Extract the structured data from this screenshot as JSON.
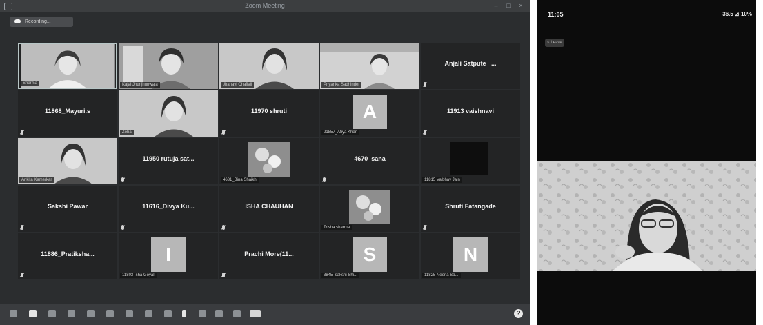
{
  "window": {
    "title": "Zoom Meeting"
  },
  "recording": {
    "label": "Recording..."
  },
  "participants": [
    {
      "name": "Sharma",
      "kind": "video",
      "active": true
    },
    {
      "name": "Kajal Jhunjhunwala",
      "kind": "video"
    },
    {
      "name": "Jhanavi Chaflali",
      "kind": "video"
    },
    {
      "name": "Priyanka Sadhinder",
      "kind": "video"
    },
    {
      "name": "Anjali Satpute _...",
      "kind": "name"
    },
    {
      "name": "11868_Mayuri.s",
      "kind": "name"
    },
    {
      "name": "Zoha",
      "kind": "video"
    },
    {
      "name": "11970 shruti",
      "kind": "name"
    },
    {
      "name": "21857_Afiya Khan",
      "kind": "letter",
      "letter": "A"
    },
    {
      "name": "11913 vaishnavi",
      "kind": "name"
    },
    {
      "name": "Ankita Kamerkar",
      "kind": "video"
    },
    {
      "name": "11950 rutuja sat...",
      "kind": "name"
    },
    {
      "name": "4631_Bina Shaikh",
      "kind": "image"
    },
    {
      "name": "4670_sana",
      "kind": "name"
    },
    {
      "name": "11815 Vaibhav Jain",
      "kind": "image-dark"
    },
    {
      "name": "Sakshi Pawar",
      "kind": "name"
    },
    {
      "name": "11616_Divya Ku...",
      "kind": "name"
    },
    {
      "name": "ISHA CHAUHAN",
      "kind": "name"
    },
    {
      "name": "Trisha sharma",
      "kind": "image"
    },
    {
      "name": "Shruti Fatangade",
      "kind": "name"
    },
    {
      "name": "11886_Pratiksha...",
      "kind": "name"
    },
    {
      "name": "11803 Isha Goyal",
      "kind": "letter",
      "letter": "I"
    },
    {
      "name": "Prachi  More(11...",
      "kind": "name"
    },
    {
      "name": "3845_sakshi Shi...",
      "kind": "letter",
      "letter": "S"
    },
    {
      "name": "11825 Neerja Sa...",
      "kind": "letter",
      "letter": "N"
    }
  ],
  "toolbar": {
    "help_label": "?"
  },
  "phone": {
    "time": "11:05",
    "status": "36.5 ⊿ 10%",
    "leave_label": "< Leave"
  },
  "colors": {
    "tile_bg": "#232425",
    "window_bg": "#2b2d2f",
    "letter_tile": "#b7b7b7"
  }
}
